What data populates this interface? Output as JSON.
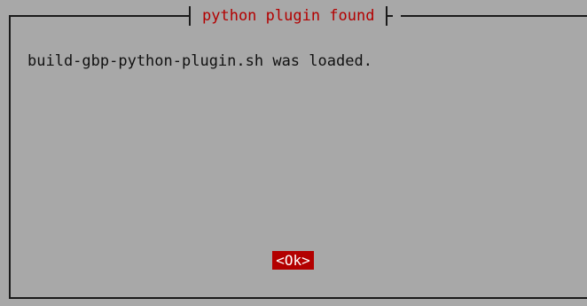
{
  "dialog": {
    "title": "python plugin found",
    "message": "build-gbp-python-plugin.sh was loaded.",
    "ok_label": "<Ok>"
  },
  "colors": {
    "background": "#a8a8a8",
    "border": "#1a1a1a",
    "title": "#b30000",
    "button_bg": "#b30000",
    "button_text": "#ffffff",
    "text": "#111111"
  }
}
